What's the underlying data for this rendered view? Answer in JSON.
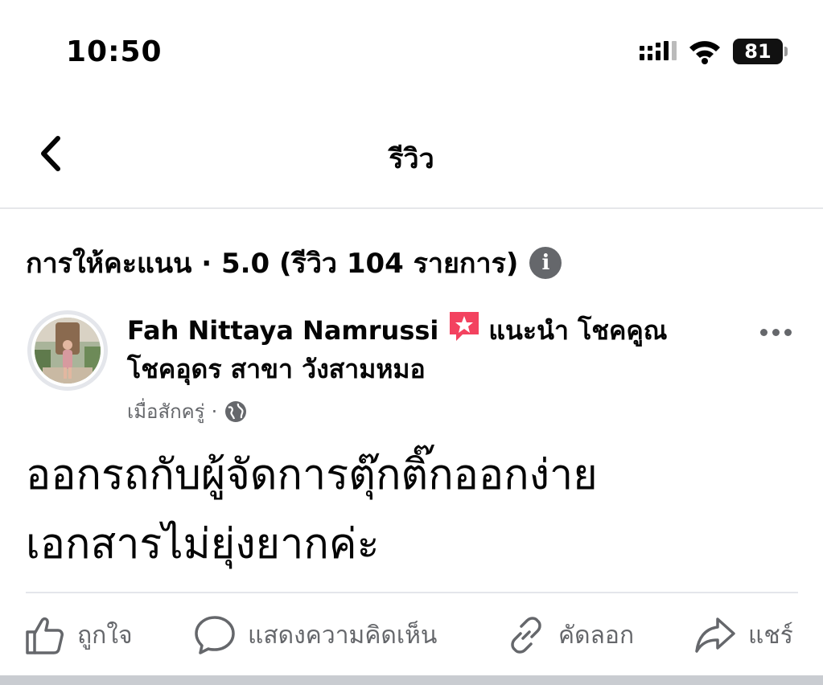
{
  "status_bar": {
    "time": "10:50",
    "battery": "81"
  },
  "nav": {
    "title": "รีวิว"
  },
  "rating": {
    "summary": "การให้คะแนน · 5.0 (รีวิว 104 รายการ)",
    "info_icon_text": "i"
  },
  "review": {
    "author": "Fah Nittaya Namrussi",
    "recommends_label": "แนะนำ",
    "page_name": "โชคคูณ โชคอุดร สาขา วังสามหมอ",
    "timestamp": "เมื่อสักครู่",
    "separator": "·",
    "privacy_icon": "globe-icon",
    "body_line1": "ออกรถกับผู้จัดการตุ๊กติ๊กออกง่าย",
    "body_line2": "เอกสารไม่ยุ่งยากค่ะ"
  },
  "actions": {
    "like": "ถูกใจ",
    "comment": "แสดงความคิดเห็น",
    "copy": "คัดลอก",
    "share": "แชร์"
  },
  "colors": {
    "text_primary": "#050505",
    "text_secondary": "#65676b",
    "recommend_badge": "#f3425f",
    "divider": "#e4e6eb"
  }
}
